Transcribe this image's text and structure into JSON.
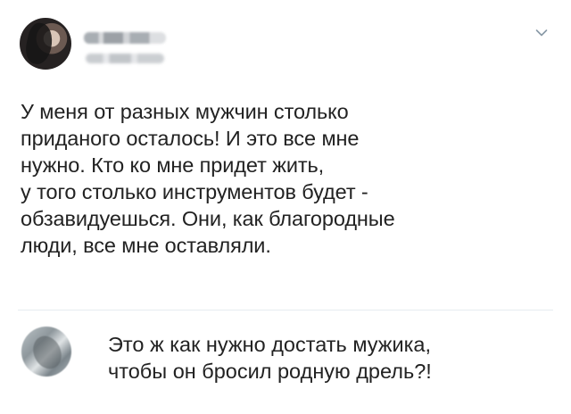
{
  "tweet": {
    "author_name": "",
    "author_handle": "",
    "text": "У меня от разных мужчин столько\nприданого осталось! И это все мне\nнужно. Кто ко мне придет жить,\nу того столько инструментов будет -\nобзавидуешься. Они, как благородные\nлюди, все мне оставляли.",
    "menu_icon": "chevron-down-icon"
  },
  "reply": {
    "text": "Это ж как нужно достать мужика,\nчтобы он бросил родную дрель?!"
  },
  "colors": {
    "text": "#222222",
    "divider": "#e6ecf0",
    "icon": "#8899a6"
  }
}
